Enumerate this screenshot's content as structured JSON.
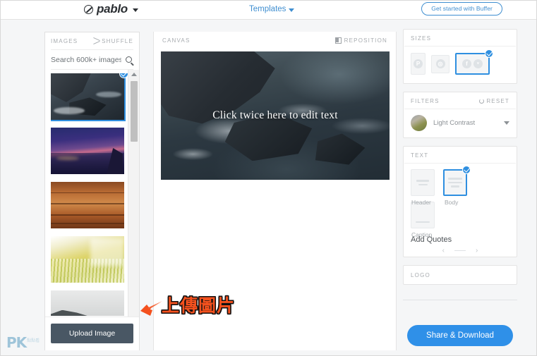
{
  "topbar": {
    "logo_text": "pablo",
    "logo_icon": "pablo-circle-slash-icon",
    "templates_label": "Templates",
    "buffer_button": "Get started with Buffer"
  },
  "images_panel": {
    "title": "IMAGES",
    "shuffle_label": "SHUFFLE",
    "search_value": "",
    "search_placeholder": "Search 600k+ images",
    "upload_button": "Upload Image",
    "thumbnails": [
      {
        "name": "rocky-coastline",
        "selected": true
      },
      {
        "name": "night-city-lights",
        "selected": false
      },
      {
        "name": "wooden-planks",
        "selected": false
      },
      {
        "name": "yellow-grass-field",
        "selected": false
      },
      {
        "name": "misty-lake-bw",
        "selected": false
      }
    ]
  },
  "canvas": {
    "title": "CANVAS",
    "reposition_label": "REPOSITION",
    "overlay_text": "Click twice here to edit text"
  },
  "sizes": {
    "title": "SIZES",
    "options": [
      {
        "name": "pinterest",
        "glyph": "P",
        "selected": false
      },
      {
        "name": "instagram",
        "glyph": "◎",
        "selected": false
      },
      {
        "name": "facebook-twitter",
        "glyph": "f",
        "glyph2": "ᵛ",
        "selected": true
      }
    ]
  },
  "filters": {
    "title": "FILTERS",
    "reset_label": "RESET",
    "selected_filter": "Light Contrast"
  },
  "text_section": {
    "title": "TEXT",
    "items": [
      {
        "label": "Header",
        "selected": false
      },
      {
        "label": "Body",
        "selected": true
      },
      {
        "label": "Caption",
        "selected": false
      }
    ],
    "add_quotes_label": "Add Quotes",
    "prev_arrow": "‹",
    "next_arrow": "›"
  },
  "logo_section": {
    "title": "LOGO"
  },
  "footer": {
    "share_button": "Share & Download"
  },
  "annotation": {
    "text": "上傳圖片",
    "arrow": "left-arrow"
  },
  "watermark": {
    "text": "PK",
    "sub": "點點看"
  },
  "colors": {
    "accent_blue": "#2f8fe0",
    "share_blue": "#2f90e8",
    "annotation_orange": "#f4511e",
    "upload_dark": "#495764"
  }
}
